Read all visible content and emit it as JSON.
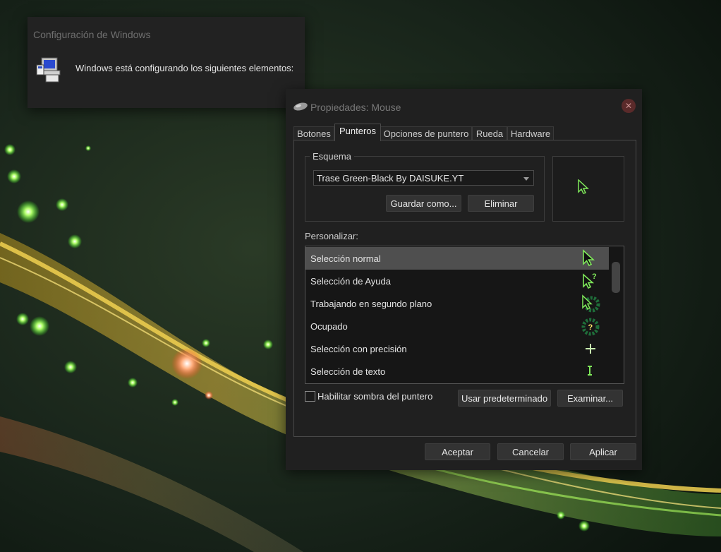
{
  "config_window": {
    "title": "Configuración de Windows",
    "message": "Windows está configurando los siguientes elementos:",
    "icon": "installer-computer-icon"
  },
  "mouse_window": {
    "title": "Propiedades: Mouse",
    "icon": "mouse-icon",
    "tabs": [
      {
        "label": "Botones",
        "active": false
      },
      {
        "label": "Punteros",
        "active": true
      },
      {
        "label": "Opciones de puntero",
        "active": false
      },
      {
        "label": "Rueda",
        "active": false
      },
      {
        "label": "Hardware",
        "active": false
      }
    ],
    "scheme": {
      "group_label": "Esquema",
      "selected": "Trase Green-Black By DAISUKE.YT",
      "save_as_label": "Guardar como...",
      "delete_label": "Eliminar"
    },
    "customize": {
      "label": "Personalizar:",
      "items": [
        {
          "label": "Selección normal",
          "icon": "arrow-cursor-icon",
          "selected": true
        },
        {
          "label": "Selección de Ayuda",
          "icon": "help-cursor-icon",
          "selected": false
        },
        {
          "label": "Trabajando en segundo plano",
          "icon": "working-cursor-icon",
          "selected": false
        },
        {
          "label": "Ocupado",
          "icon": "busy-cursor-icon",
          "selected": false
        },
        {
          "label": "Selección con precisión",
          "icon": "crosshair-cursor-icon",
          "selected": false
        },
        {
          "label": "Selección de texto",
          "icon": "text-cursor-icon",
          "selected": false
        }
      ]
    },
    "shadow_checkbox": {
      "label": "Habilitar sombra del puntero",
      "checked": false
    },
    "use_default_label": "Usar predeterminado",
    "browse_label": "Examinar...",
    "ok_label": "Aceptar",
    "cancel_label": "Cancelar",
    "apply_label": "Aplicar"
  },
  "colors": {
    "accent_green": "#6ee04a",
    "window_bg": "#202020"
  }
}
